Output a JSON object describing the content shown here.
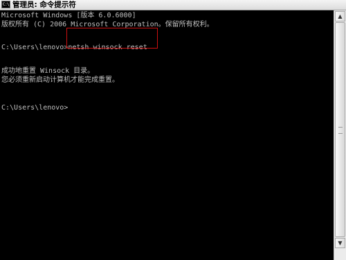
{
  "window": {
    "title": "管理员: 命令提示符",
    "icon": "cmd-icon",
    "icon_text": "C:\\"
  },
  "console": {
    "lines": [
      "Microsoft Windows [版本 6.0.6000]",
      "版权所有 (C) 2006 Microsoft Corporation。保留所有权利。",
      "C:\\Users\\lenovo>netsh winsock reset",
      "成功地重置 Winsock 目录。",
      "您必须重新启动计算机才能完成重置。",
      "C:\\Users\\lenovo>"
    ]
  },
  "scrollbar": {
    "up_icon": "scroll-up-arrow-icon",
    "down_icon": "scroll-down-arrow-icon",
    "up_glyph": "▲",
    "down_glyph": "▼"
  },
  "colors": {
    "console_background": "#000000",
    "console_text": "#c0c0c0",
    "highlight_border": "#d01010"
  }
}
